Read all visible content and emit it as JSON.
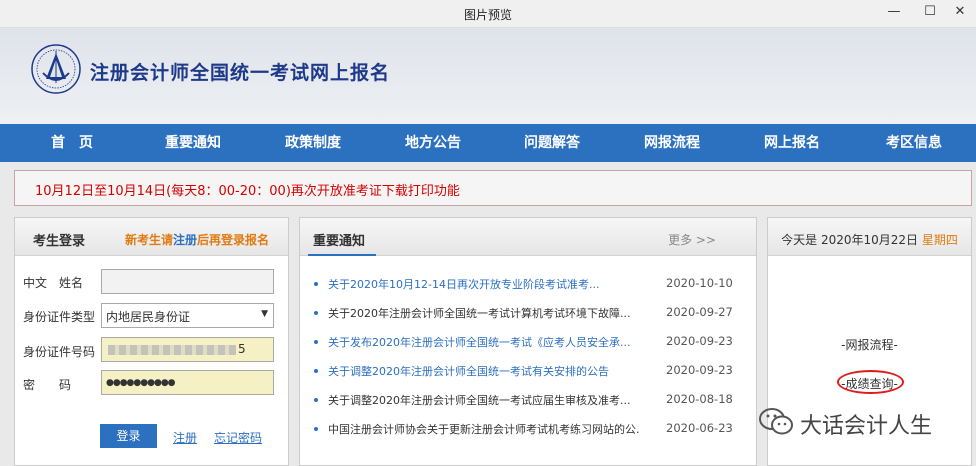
{
  "window": {
    "title": "图片预览",
    "controls": [
      "minimize",
      "maximize",
      "close"
    ],
    "minimize_glyph": "—",
    "maximize_glyph": "☐",
    "close_glyph": "✕"
  },
  "header": {
    "logo_icon": "cicpa-emblem-icon",
    "site_title": "注册会计师全国统一考试网上报名"
  },
  "nav": {
    "items": [
      {
        "label": "首　页"
      },
      {
        "label": "重要通知"
      },
      {
        "label": "政策制度"
      },
      {
        "label": "地方公告"
      },
      {
        "label": "问题解答"
      },
      {
        "label": "网报流程"
      },
      {
        "label": "网上报名"
      },
      {
        "label": "考区信息"
      }
    ]
  },
  "notice": {
    "text": "10月12日至10月14日(每天8：00-20：00)再次开放准考证下载打印功能"
  },
  "login": {
    "title": "考生登录",
    "hint_prefix": "新考生请",
    "hint_link": "注册",
    "hint_suffix": "后再登录报名",
    "name_label": "中文　姓名",
    "name_value": "",
    "id_type_label": "身份证件类型",
    "id_type_value": "内地居民身份证",
    "id_number_label": "身份证件号码",
    "id_number_value_tail": "5",
    "password_label": "密　　码",
    "password_value": "●●●●●●●●●●",
    "login_button": "登录",
    "register_link": "注册",
    "forgot_link": "忘记密码"
  },
  "news": {
    "title": "重要通知",
    "more": "更多 >>",
    "items": [
      {
        "title": "关于2020年10月12-14日再次开放专业阶段考试准考...",
        "date": "2020-10-10"
      },
      {
        "title": "关于2020年注册会计师全国统一考试计算机考试环境下故障...",
        "date": "2020-09-27"
      },
      {
        "title": "关于发布2020年注册会计师全国统一考试《应考人员安全承...",
        "date": "2020-09-23"
      },
      {
        "title": "关于调整2020年注册会计师全国统一考试有关安排的公告",
        "date": "2020-09-23"
      },
      {
        "title": "关于调整2020年注册会计师全国统一考试应届生审核及准考...",
        "date": "2020-08-18"
      },
      {
        "title": "中国注册会计师协会关于更新注册会计师考试机考练习网站的公...",
        "date": "2020-06-23"
      }
    ]
  },
  "today": {
    "prefix": "今天是 2020年10月22日",
    "weekday": "星期四",
    "process_link": "-网报流程-",
    "score_link": "-成绩查询-"
  },
  "watermark": {
    "icon": "wechat-icon",
    "text": "大话会计人生"
  },
  "colors": {
    "nav_blue": "#2c70c0",
    "title_blue": "#1d3a8a",
    "notice_red": "#d40000",
    "accent_orange": "#e07b12",
    "highlight_red": "#e01b1b"
  }
}
